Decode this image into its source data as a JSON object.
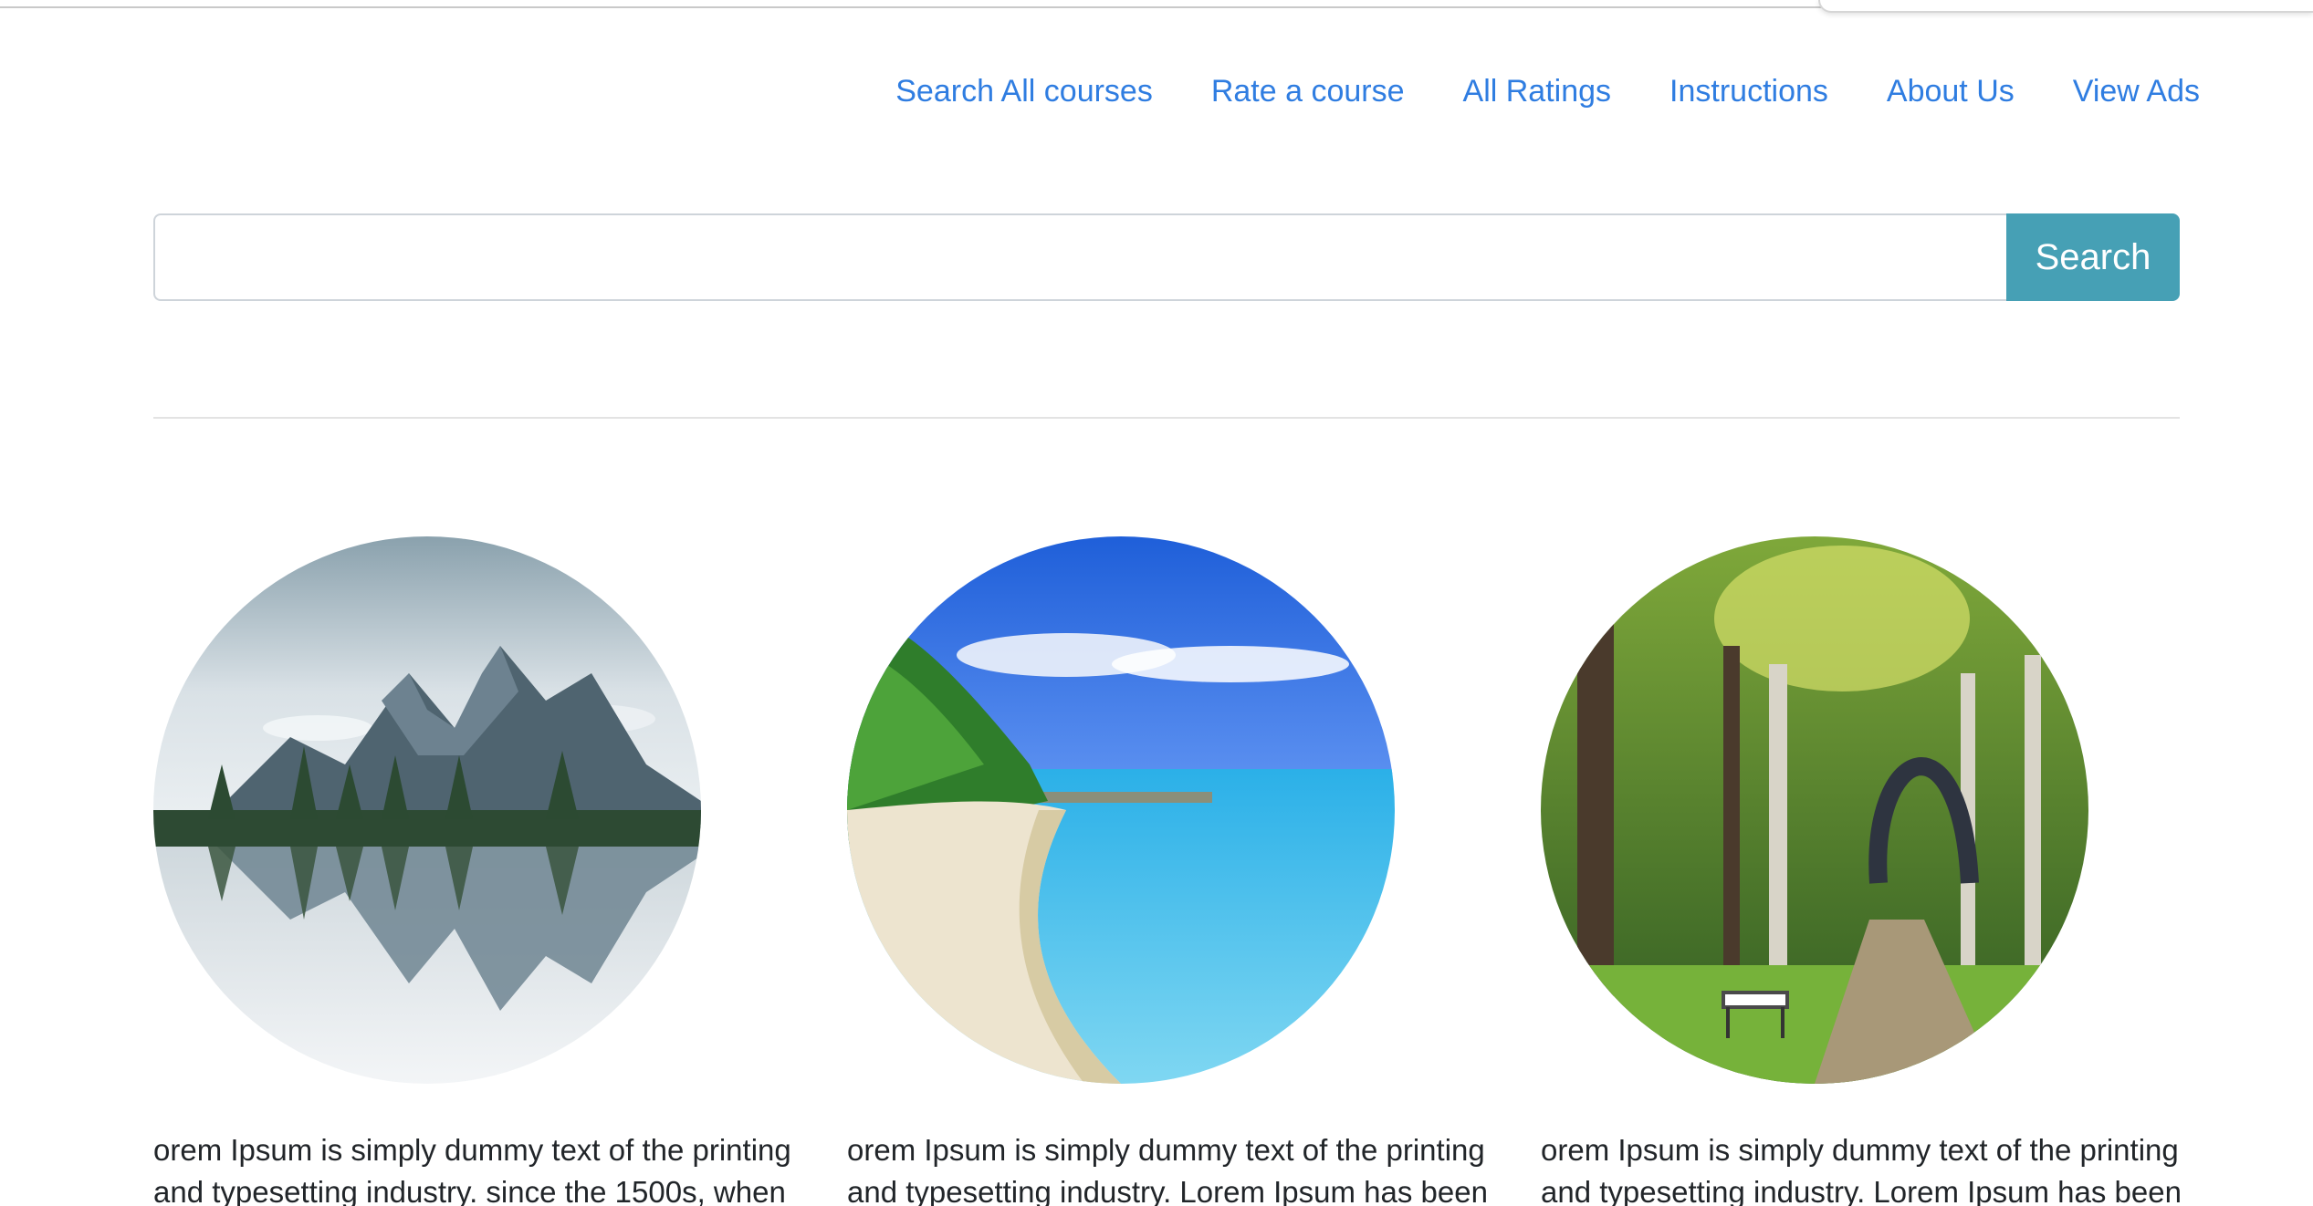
{
  "nav": {
    "items": [
      {
        "label": "Search All courses"
      },
      {
        "label": "Rate a course"
      },
      {
        "label": "All Ratings"
      },
      {
        "label": "Instructions"
      },
      {
        "label": "About Us"
      },
      {
        "label": "View Ads"
      }
    ]
  },
  "search": {
    "value": "",
    "placeholder": "",
    "button_label": "Search"
  },
  "cards": [
    {
      "image": "mountain-lake-reflection",
      "text": "orem Ipsum is simply dummy text of the printing and typesetting industry. since the 1500s, when"
    },
    {
      "image": "tropical-beach",
      "text": "orem Ipsum is simply dummy text of the printing and typesetting industry. Lorem Ipsum has been"
    },
    {
      "image": "forest-park-path",
      "text": "orem Ipsum is simply dummy text of the printing and typesetting industry. Lorem Ipsum has been"
    }
  ],
  "colors": {
    "link": "#2f7de1",
    "button": "#46a0b5",
    "text": "#212529"
  }
}
